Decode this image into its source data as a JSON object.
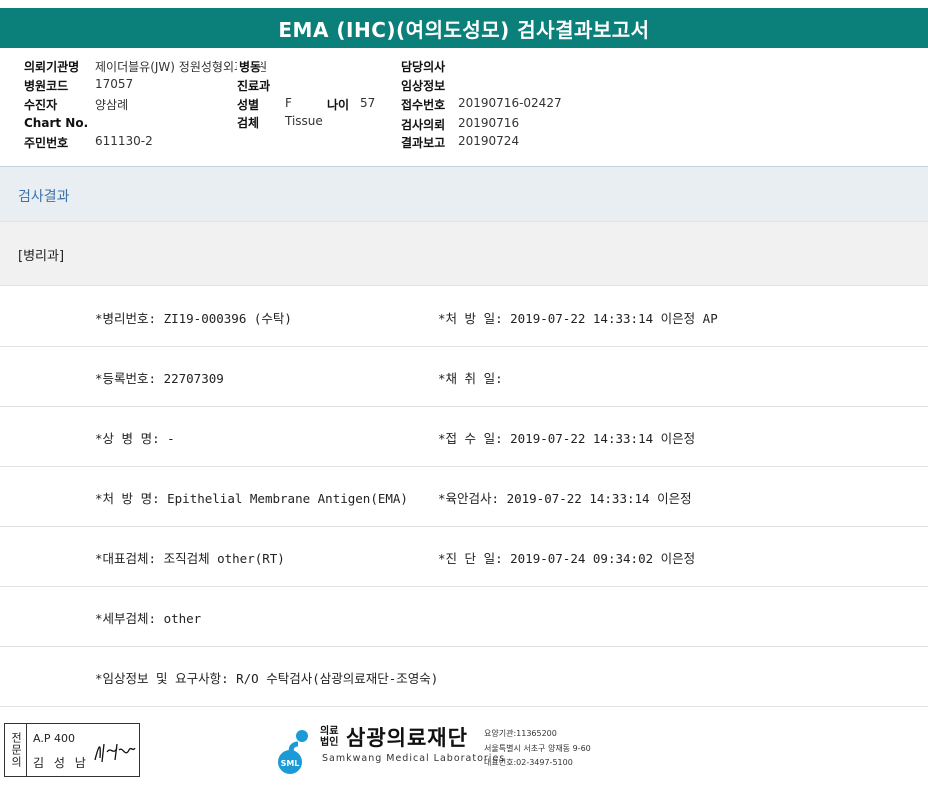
{
  "report_title": "EMA (IHC)(여의도성모) 검사결과보고서",
  "info": {
    "hospital_label": "의뢰기관명",
    "hospital_value": "제이더블유(JW) 정원성형외과의원",
    "code_label": "병원코드",
    "code_value": "17057",
    "patient_label": "수진자",
    "patient_value": "양삼례",
    "chart_label": "Chart No.",
    "chart_value": "",
    "resident_label": "주민번호",
    "resident_value": "611130-2",
    "ward_label": "병동",
    "dept_label": "진료과",
    "sex_label": "성별",
    "sex_value": "F",
    "age_label": "나이",
    "age_value": "57",
    "specimen_label": "검체",
    "specimen_value": "Tissue",
    "doctor_label": "담당의사",
    "clinical_label": "임상정보",
    "receipt_label": "접수번호",
    "receipt_value": "20190716-02427",
    "request_label": "검사의뢰",
    "request_value": "20190716",
    "report_label": "결과보고",
    "report_value": "20190724"
  },
  "section_title": "검사결과",
  "sub_title": "[병리과]",
  "rows": [
    {
      "left": "*병리번호: ZI19-000396 (수탁)",
      "right": "*처 방 일: 2019-07-22 14:33:14  이은정 AP"
    },
    {
      "left": "*등록번호: 22707309",
      "right": "*채 취 일:"
    },
    {
      "left": "*상 병 명: -",
      "right": "*접 수 일: 2019-07-22 14:33:14  이은정"
    },
    {
      "left": "*처 방 명: Epithelial Membrane Antigen(EMA)",
      "right": "*육안검사: 2019-07-22 14:33:14  이은정"
    },
    {
      "left": "*대표검체: 조직검체 other(RT)",
      "right": "*진 단 일: 2019-07-24 09:34:02  이은정"
    },
    {
      "left": "*세부검체: other",
      "right": ""
    },
    {
      "left": "*임상정보 및 요구사항: R/O 수탁검사(삼광의료재단-조영숙)",
      "right": ""
    }
  ],
  "footer": {
    "specialist_side": "전문의",
    "ap_code": "A.P 400",
    "specialist_name": "김 성 남",
    "logo_text": "SML",
    "org_small": "의료 법인",
    "org_name": "삼광의료재단",
    "org_english": "Samkwang Medical Laboratories",
    "org_code": "요양기관:11365200",
    "org_address": "서울특별시 서초구 양재동 9-60",
    "org_phone": "대표번호:02-3497-5100"
  },
  "colors": {
    "header": "#0b7f7a",
    "section_text": "#3d72a8",
    "logo": "#1a9ad6"
  }
}
